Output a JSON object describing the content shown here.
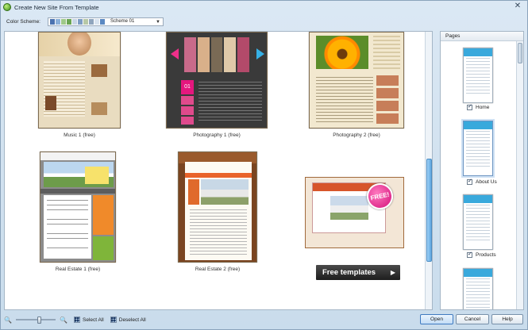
{
  "window": {
    "title": "Create New Site From Template",
    "close_glyph": "✕"
  },
  "scheme": {
    "label": "Color Scheme:",
    "selected": "Scheme 01",
    "swatches": [
      "#4b73b0",
      "#8bb0d9",
      "#9fc98a",
      "#6aa553",
      "#c9d6e6",
      "#7d9dc4",
      "#b7c8a7",
      "#8fa5bd",
      "#d9e4f0",
      "#5b89c2"
    ]
  },
  "templates": [
    {
      "caption": "Music 1 (free)"
    },
    {
      "caption": "Photography 1 (free)"
    },
    {
      "caption": "Photography 2 (free)"
    },
    {
      "caption": "Real Estate 1 (free)"
    },
    {
      "caption": "Real Estate 2 (free)"
    }
  ],
  "promo": {
    "badge": "FREE!",
    "banner": "Free templates",
    "banner_arrow": "▶"
  },
  "pages": {
    "header": "Pages",
    "items": [
      {
        "label": "Home",
        "checked": true
      },
      {
        "label": "About Us",
        "checked": true
      },
      {
        "label": "Products",
        "checked": true
      }
    ]
  },
  "toolbar": {
    "zoom_out_glyph": "🔍",
    "zoom_in_glyph": "🔍",
    "zoom_level": 0.6,
    "select_all": "Select All",
    "deselect_all": "Deselect All"
  },
  "buttons": {
    "open": "Open",
    "cancel": "Cancel",
    "help": "Help"
  }
}
